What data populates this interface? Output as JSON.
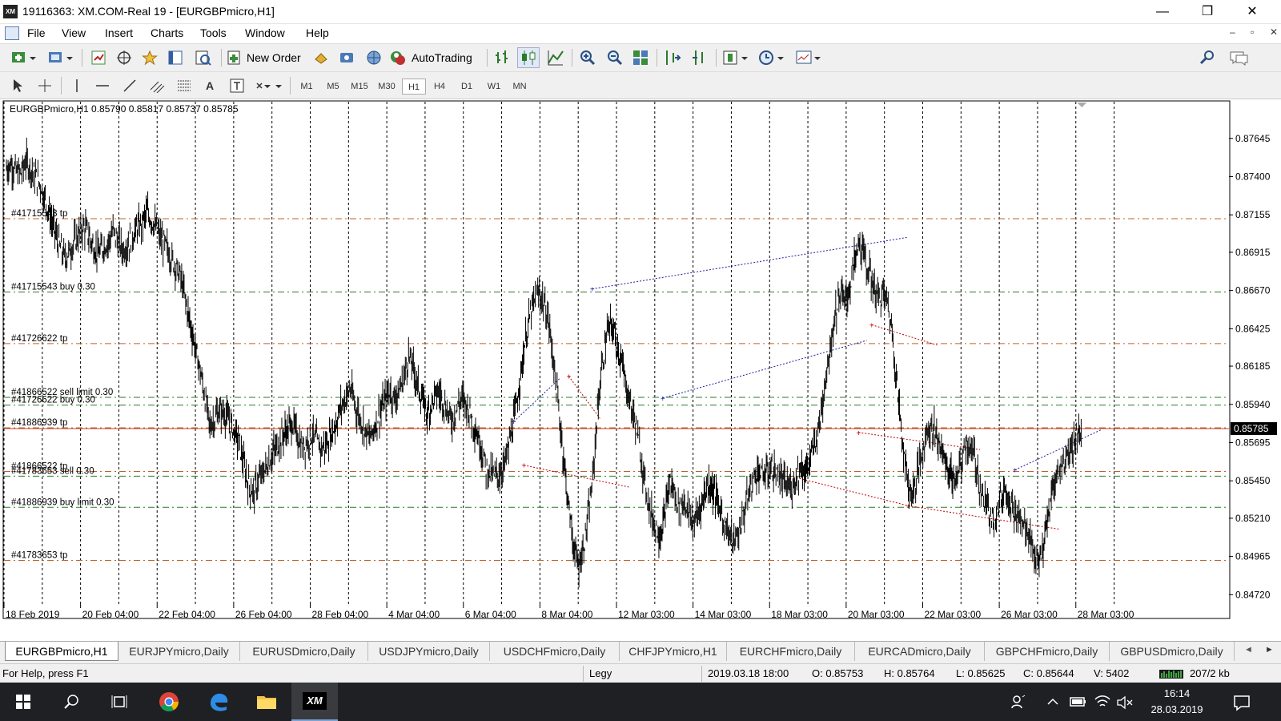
{
  "window": {
    "title": "19116363: XM.COM-Real 19 - [EURGBPmicro,H1]",
    "app_icon_text": "XM",
    "minimize": "—",
    "maximize": "❐",
    "close": "✕"
  },
  "menu": {
    "items": [
      "File",
      "View",
      "Insert",
      "Charts",
      "Tools",
      "Window",
      "Help"
    ],
    "mdi_min": "–",
    "mdi_restore": "▫",
    "mdi_close": "✕"
  },
  "toolbar": {
    "new_order": "New Order",
    "autotrading": "AutoTrading",
    "timeframes": [
      "M1",
      "M5",
      "M15",
      "M30",
      "H1",
      "H4",
      "D1",
      "W1",
      "MN"
    ],
    "active_timeframe": "H1",
    "text_tool": "A"
  },
  "chart": {
    "header": "EURGBPmicro,H1  0.85790 0.85817 0.85737 0.85785",
    "current_price": "0.85785",
    "grid_color": "#000000",
    "up_color": "#000000"
  },
  "chart_data": {
    "type": "candlestick",
    "symbol": "EURGBPmicro",
    "timeframe": "H1",
    "ohlc_last": {
      "open": 0.8579,
      "high": 0.85817,
      "low": 0.85737,
      "close": 0.85785
    },
    "y_ticks": [
      0.87645,
      0.874,
      0.87155,
      0.86915,
      0.8667,
      0.86425,
      0.86185,
      0.8594,
      0.85695,
      0.8545,
      0.8521,
      0.84965,
      0.8472
    ],
    "y_tick_labels": [
      "0.87645",
      "0.87400",
      "0.87155",
      "0.86915",
      "0.86670",
      "0.86425",
      "0.86185",
      "0.85940",
      "0.85695",
      "0.85450",
      "0.85210",
      "0.84965",
      "0.84720"
    ],
    "x_labels": [
      "18 Feb 2019",
      "20 Feb 04:00",
      "22 Feb 04:00",
      "26 Feb 04:00",
      "28 Feb 04:00",
      "4 Mar 04:00",
      "6 Mar 04:00",
      "8 Mar 04:00",
      "12 Mar 03:00",
      "14 Mar 03:00",
      "18 Mar 03:00",
      "20 Mar 03:00",
      "22 Mar 03:00",
      "26 Mar 03:00",
      "28 Mar 03:00"
    ],
    "series": [
      {
        "points": [
          0.8745,
          0.8748,
          0.8743,
          0.8742,
          0.875,
          0.8745,
          0.874,
          0.8735,
          0.8725,
          0.8715,
          0.8705,
          0.8695,
          0.8688,
          0.8692,
          0.8698,
          0.8703,
          0.8708,
          0.8702,
          0.8695,
          0.869,
          0.8695,
          0.8698,
          0.8705,
          0.8699,
          0.8693,
          0.8696,
          0.8702,
          0.8707,
          0.871,
          0.8717,
          0.8712,
          0.8706,
          0.8699,
          0.8695,
          0.8688,
          0.8682,
          0.8675,
          0.866,
          0.8645,
          0.863,
          0.8615,
          0.8598,
          0.858,
          0.8585,
          0.859,
          0.8588,
          0.8583,
          0.8577,
          0.857,
          0.8555,
          0.8542,
          0.8537,
          0.8545,
          0.855,
          0.8556,
          0.8562,
          0.8568,
          0.8574,
          0.8578,
          0.8582,
          0.8574,
          0.8566,
          0.857,
          0.8575,
          0.857,
          0.8566,
          0.8568,
          0.8575,
          0.8582,
          0.8592,
          0.8598,
          0.8604,
          0.8593,
          0.8585,
          0.8578,
          0.8572,
          0.858,
          0.8588,
          0.8595,
          0.8603,
          0.8598,
          0.8602,
          0.8611,
          0.8625,
          0.8617,
          0.8605,
          0.8595,
          0.8588,
          0.8597,
          0.8602,
          0.8598,
          0.8589,
          0.8584,
          0.8592,
          0.8598,
          0.8594,
          0.8586,
          0.8576,
          0.8567,
          0.8553,
          0.855,
          0.8548,
          0.855,
          0.8558,
          0.8572,
          0.8588,
          0.861,
          0.8632,
          0.865,
          0.866,
          0.8665,
          0.8658,
          0.8645,
          0.862,
          0.859,
          0.856,
          0.853,
          0.8505,
          0.849,
          0.85,
          0.852,
          0.8545,
          0.859,
          0.862,
          0.864,
          0.8645,
          0.8633,
          0.862,
          0.8605,
          0.8592,
          0.858,
          0.856,
          0.854,
          0.8525,
          0.8515,
          0.851,
          0.8525,
          0.8545,
          0.8535,
          0.8528,
          0.8532,
          0.8522,
          0.8518,
          0.8526,
          0.8536,
          0.8544,
          0.8538,
          0.853,
          0.852,
          0.8512,
          0.8506,
          0.851,
          0.8522,
          0.8534,
          0.8545,
          0.8552,
          0.8548,
          0.855,
          0.8553,
          0.8548,
          0.8545,
          0.8542,
          0.854,
          0.8548,
          0.8554,
          0.855,
          0.856,
          0.857,
          0.8584,
          0.861,
          0.863,
          0.865,
          0.8665,
          0.866,
          0.8668,
          0.8685,
          0.8698,
          0.869,
          0.8678,
          0.867,
          0.8662,
          0.8665,
          0.8658,
          0.8635,
          0.86,
          0.857,
          0.8545,
          0.8535,
          0.855,
          0.8562,
          0.8578,
          0.858,
          0.8575,
          0.8565,
          0.8555,
          0.8548,
          0.8545,
          0.8555,
          0.857,
          0.8565,
          0.8558,
          0.854,
          0.853,
          0.8525,
          0.8522,
          0.853,
          0.854,
          0.8535,
          0.8525,
          0.852,
          0.8516,
          0.8512,
          0.85,
          0.849,
          0.8502,
          0.852,
          0.854,
          0.855,
          0.8555,
          0.8562,
          0.8568,
          0.8575,
          0.8579
        ]
      }
    ],
    "horizontal_lines": [
      {
        "label": "#41715543 tp",
        "price": 0.8713
      },
      {
        "label": "#41715543 buy 0.30",
        "price": 0.8666
      },
      {
        "label": "#41726622 tp",
        "price": 0.8633
      },
      {
        "label": "#41866522 sell limit 0.30",
        "price": 0.85985
      },
      {
        "label": "#41726622 buy 0.30",
        "price": 0.85935
      },
      {
        "label": "#41886939 tp",
        "price": 0.8579
      },
      {
        "label": "#41866522 tp",
        "price": 0.8551
      },
      {
        "label": "#41783653 sell 0.30",
        "price": 0.8548
      },
      {
        "label": "#41886939 buy limit 0.30",
        "price": 0.8528
      },
      {
        "label": "#41783653 tp",
        "price": 0.8494
      }
    ],
    "trade_links": [
      {
        "from": [
          0.6418,
          0.8548
        ],
        "to": [
          0.7383,
          0.8529
        ],
        "color": "#c00000"
      },
      {
        "from": [
          0.7383,
          0.8529
        ],
        "to": [
          0.8614,
          0.8514
        ],
        "color": "#c00000"
      },
      {
        "from": [
          0.4803,
          0.8668
        ],
        "to": [
          0.7371,
          0.8701
        ],
        "color": "#1e1ea0"
      },
      {
        "from": [
          0.5378,
          0.8598
        ],
        "to": [
          0.7043,
          0.8635
        ],
        "color": "#1e1ea0"
      },
      {
        "from": [
          0.4162,
          0.8583
        ],
        "to": [
          0.4542,
          0.8611
        ],
        "color": "#1e1ea0"
      },
      {
        "from": [
          0.8253,
          0.8552
        ],
        "to": [
          0.8964,
          0.8578
        ],
        "color": "#1e1ea0"
      },
      {
        "from": [
          0.7084,
          0.8645
        ],
        "to": [
          0.7618,
          0.8632
        ],
        "color": "#c00000"
      },
      {
        "from": [
          0.6976,
          0.8576
        ],
        "to": [
          0.7968,
          0.8565
        ],
        "color": "#c00000"
      },
      {
        "from": [
          0.4244,
          0.8555
        ],
        "to": [
          0.5101,
          0.8541
        ],
        "color": "#c00000"
      },
      {
        "from": [
          0.4611,
          0.8612
        ],
        "to": [
          0.4865,
          0.8585
        ],
        "color": "#c00000"
      }
    ],
    "grid": true
  },
  "tabs": [
    "EURGBPmicro,H1",
    "EURJPYmicro,Daily",
    "EURUSDmicro,Daily",
    "USDJPYmicro,Daily",
    "USDCHFmicro,Daily",
    "CHFJPYmicro,H1",
    "EURCHFmicro,Daily",
    "EURCADmicro,Daily",
    "GBPCHFmicro,Daily",
    "GBPUSDmicro,Daily"
  ],
  "tab_scroll_left": "◄",
  "tab_scroll_right": "►",
  "status": {
    "help": "For Help, press F1",
    "profile": "Legy",
    "datetime": "2019.03.18 18:00",
    "open": "O: 0.85753",
    "high": "H: 0.85764",
    "low": "L: 0.85625",
    "close": "C: 0.85644",
    "volume": "V: 5402",
    "traffic": "207/2 kb"
  },
  "taskbar": {
    "time": "16:14",
    "date": "28.03.2019",
    "xm_label": "XM"
  }
}
